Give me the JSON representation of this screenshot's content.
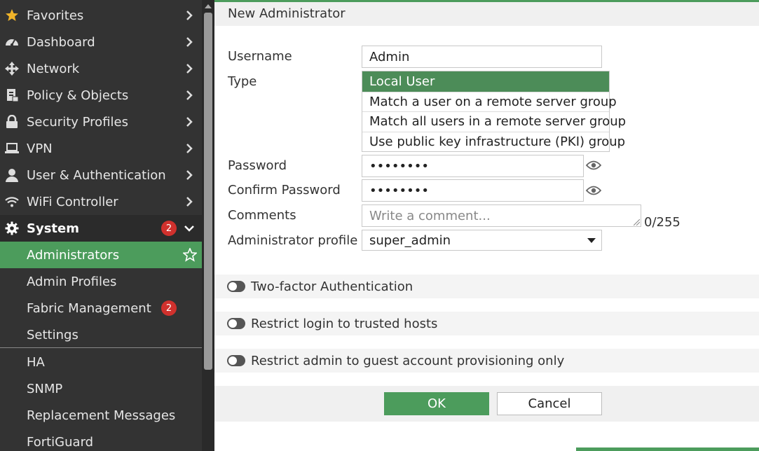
{
  "sidebar": {
    "items": [
      {
        "label": "Favorites",
        "icon": "star-icon"
      },
      {
        "label": "Dashboard",
        "icon": "dashboard-icon"
      },
      {
        "label": "Network",
        "icon": "network-icon"
      },
      {
        "label": "Policy & Objects",
        "icon": "policy-icon"
      },
      {
        "label": "Security Profiles",
        "icon": "lock-icon"
      },
      {
        "label": "VPN",
        "icon": "laptop-icon"
      },
      {
        "label": "User & Authentication",
        "icon": "user-icon"
      },
      {
        "label": "WiFi Controller",
        "icon": "wifi-icon"
      },
      {
        "label": "System",
        "icon": "gear-icon",
        "badge": "2"
      }
    ],
    "sub_items": [
      {
        "label": "Administrators"
      },
      {
        "label": "Admin Profiles"
      },
      {
        "label": "Fabric Management",
        "badge": "2"
      },
      {
        "label": "Settings"
      },
      {
        "label": "HA"
      },
      {
        "label": "SNMP"
      },
      {
        "label": "Replacement Messages"
      },
      {
        "label": "FortiGuard"
      }
    ]
  },
  "header": {
    "title": "New Administrator"
  },
  "form": {
    "username_label": "Username",
    "username_value": "Admin",
    "type_label": "Type",
    "type_options": [
      "Local User",
      "Match a user on a remote server group",
      "Match all users in a remote server group",
      "Use public key infrastructure (PKI) group"
    ],
    "password_label": "Password",
    "password_value": "••••••••",
    "confirm_label": "Confirm Password",
    "confirm_value": "••••••••",
    "comments_label": "Comments",
    "comments_placeholder": "Write a comment...",
    "comments_counter": "0/255",
    "profile_label": "Administrator profile",
    "profile_value": "super_admin"
  },
  "toggles": {
    "two_factor": "Two-factor Authentication",
    "trusted_hosts": "Restrict login to trusted hosts",
    "guest_only": "Restrict admin to guest account provisioning only"
  },
  "footer": {
    "ok_label": "OK",
    "cancel_label": "Cancel"
  },
  "colors": {
    "accent": "#4c9c5c",
    "sidebar": "#333333",
    "badge": "#d0312d"
  }
}
